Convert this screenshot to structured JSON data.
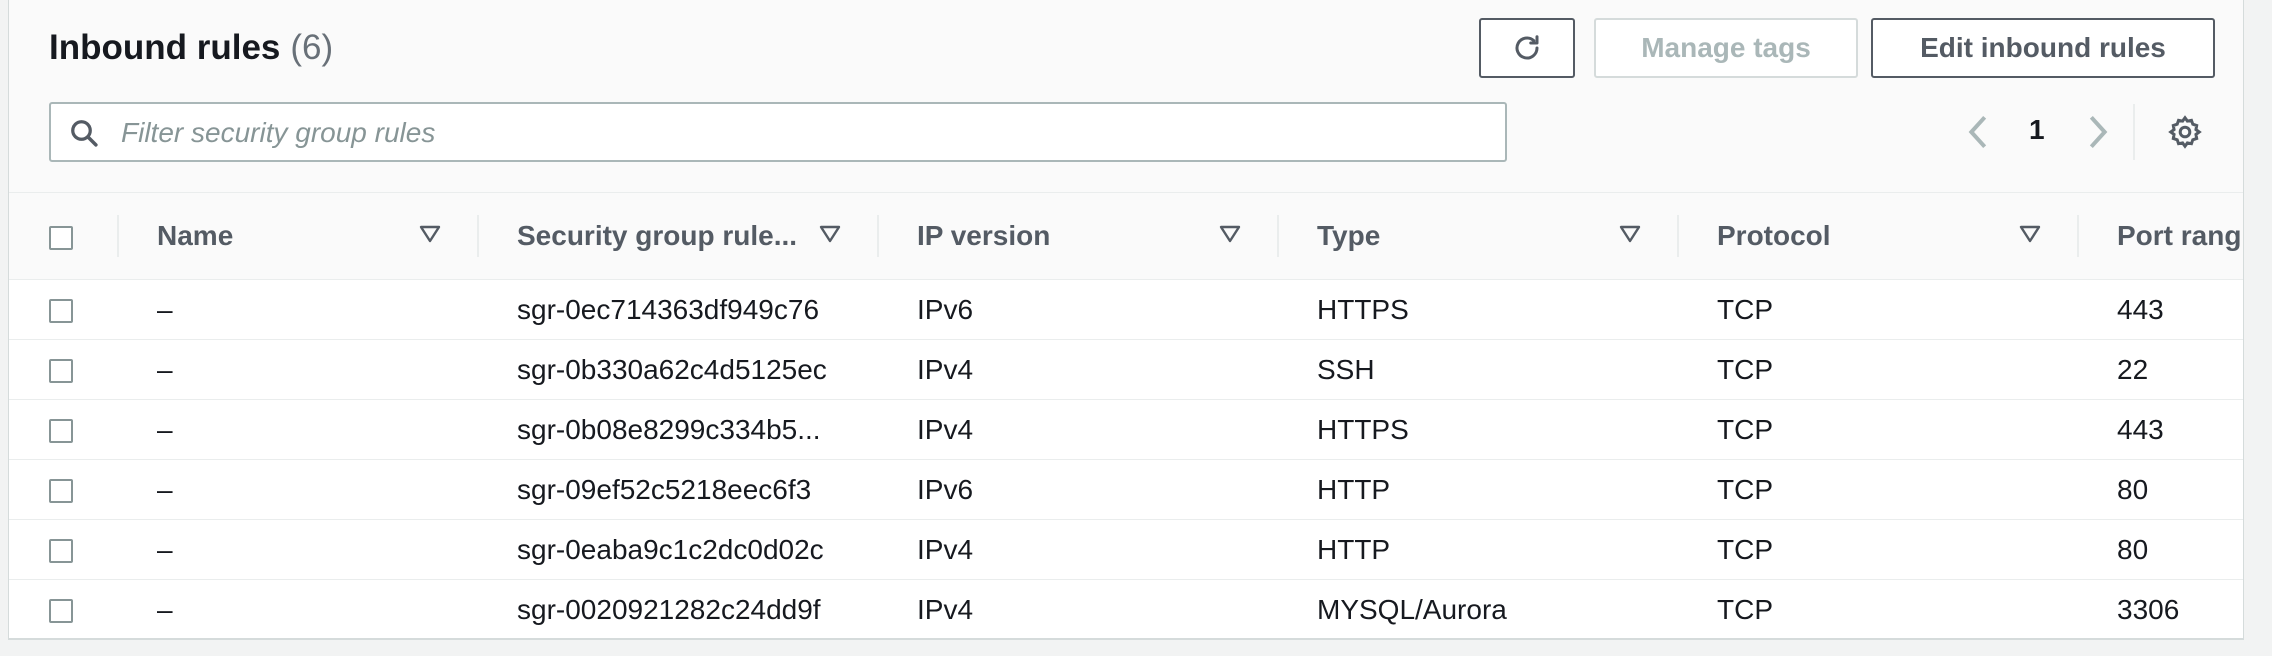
{
  "header": {
    "title": "Inbound rules",
    "count": "(6)",
    "manage_tags_label": "Manage tags",
    "edit_label": "Edit inbound rules"
  },
  "search": {
    "placeholder": "Filter security group rules"
  },
  "pager": {
    "page": "1"
  },
  "table": {
    "columns": [
      {
        "label": "Name"
      },
      {
        "label": "Security group rule..."
      },
      {
        "label": "IP version"
      },
      {
        "label": "Type"
      },
      {
        "label": "Protocol"
      },
      {
        "label": "Port rang"
      }
    ],
    "rows": [
      {
        "name": "–",
        "rule_id": "sgr-0ec714363df949c76",
        "ip_version": "IPv6",
        "type": "HTTPS",
        "protocol": "TCP",
        "port": "443"
      },
      {
        "name": "–",
        "rule_id": "sgr-0b330a62c4d5125ec",
        "ip_version": "IPv4",
        "type": "SSH",
        "protocol": "TCP",
        "port": "22"
      },
      {
        "name": "–",
        "rule_id": "sgr-0b08e8299c334b5...",
        "ip_version": "IPv4",
        "type": "HTTPS",
        "protocol": "TCP",
        "port": "443"
      },
      {
        "name": "–",
        "rule_id": "sgr-09ef52c5218eec6f3",
        "ip_version": "IPv6",
        "type": "HTTP",
        "protocol": "TCP",
        "port": "80"
      },
      {
        "name": "–",
        "rule_id": "sgr-0eaba9c1c2dc0d02c",
        "ip_version": "IPv4",
        "type": "HTTP",
        "protocol": "TCP",
        "port": "80"
      },
      {
        "name": "–",
        "rule_id": "sgr-0020921282c24dd9f",
        "ip_version": "IPv4",
        "type": "MYSQL/Aurora",
        "protocol": "TCP",
        "port": "3306"
      }
    ]
  },
  "icons": {
    "refresh": "refresh-icon",
    "search": "search-icon",
    "prev": "chevron-left-icon",
    "next": "chevron-right-icon",
    "settings": "gear-icon",
    "sort": "sort-down-icon"
  },
  "colors": {
    "text": "#16191f",
    "secondary": "#545b64",
    "disabled": "#aab7b8",
    "border": "#eaeded"
  }
}
